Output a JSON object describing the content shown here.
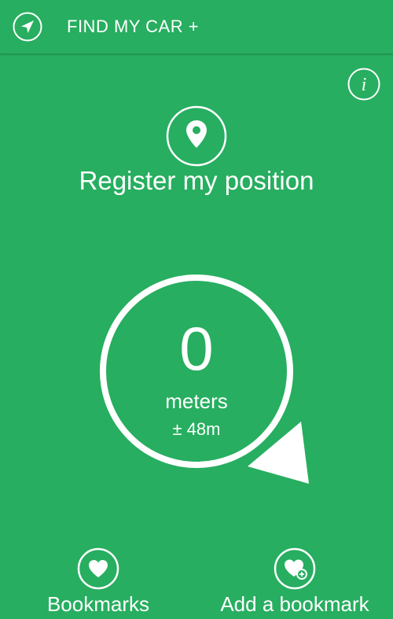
{
  "header": {
    "title": "FIND MY CAR +",
    "nav_icon": "navigation-arrow-icon"
  },
  "info": {
    "icon": "info-icon",
    "glyph": "i"
  },
  "register": {
    "icon": "location-pin-icon",
    "label": "Register my position"
  },
  "compass": {
    "distance_value": "0",
    "unit": "meters",
    "accuracy": "± 48m",
    "pointer_icon": "direction-pointer-icon"
  },
  "bookmarks": {
    "icon": "heart-icon",
    "label": "Bookmarks"
  },
  "add_bookmark": {
    "icon": "heart-add-icon",
    "label": "Add a bookmark"
  },
  "colors": {
    "background": "#27ae60",
    "foreground": "#ffffff"
  }
}
